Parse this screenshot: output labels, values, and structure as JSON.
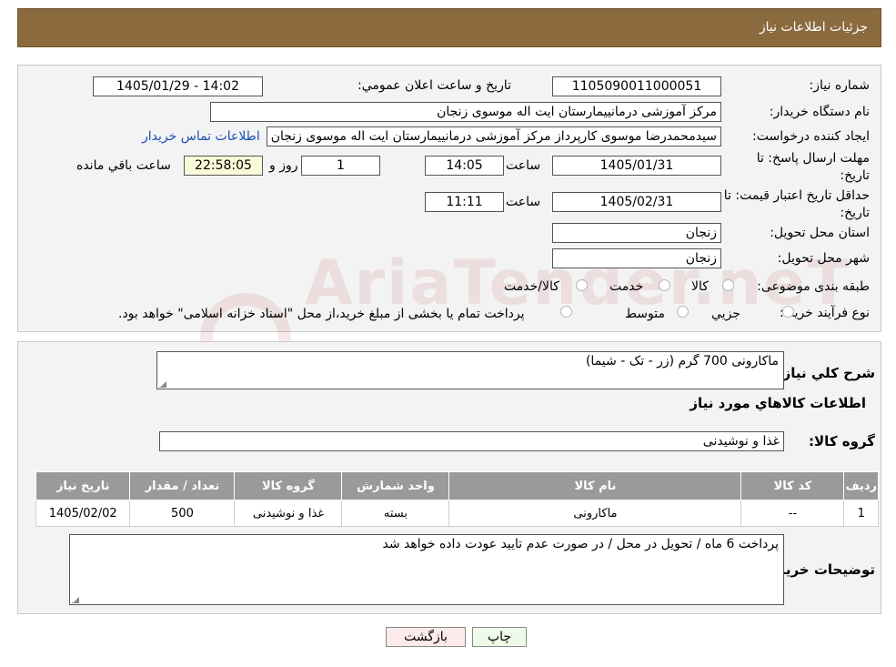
{
  "header": {
    "title": "جزئیات اطلاعات نیاز"
  },
  "form": {
    "need_number_label": "شماره نیاز:",
    "need_number": "1105090011000051",
    "announce_label": "تاریخ و ساعت اعلان عمومي:",
    "announce_value": "1405/01/29 - 14:02",
    "buyer_org_label": "نام دستگاه خريدار:",
    "buyer_org": "مرکز آموزشی درمانییمارستان ایت اله موسوی زنجان",
    "creator_label": "ايجاد کننده درخواست:",
    "creator": "سیدمحمدرضا موسوی کارپرداز مرکز آموزشی درمانییمارستان ایت اله موسوی زنجان",
    "contact_link": "اطلاعات تماس خريدار",
    "deadline_label_1": "مهلت ارسال پاسخ: تا",
    "deadline_label_2": "تاريخ:",
    "deadline_date": "1405/01/31",
    "time_label": "ساعت",
    "deadline_time": "14:05",
    "days_value": "1",
    "days_label": "روز و",
    "remaining_time": "22:58:05",
    "remaining_label": "ساعت باقي مانده",
    "validity_label_1": "حداقل تاريخ اعتبار قيمت: تا",
    "validity_label_2": "تاريخ:",
    "validity_date": "1405/02/31",
    "validity_time": "11:11",
    "province_label": "استان محل تحويل:",
    "province": "زنجان",
    "city_label": "شهر محل تحويل:",
    "city": "زنجان",
    "category_label": "طبقه بندی موضوعی:",
    "category_options": [
      "کالا",
      "خدمت",
      "کالا/خدمت"
    ],
    "process_label": "نوع فرآیند خرید :",
    "process_options": [
      "جزيي",
      "متوسط"
    ],
    "process_note": "پرداخت تمام يا بخشی از مبلغ خريد،از محل \"اسناد خزانه اسلامی\" خواهد بود."
  },
  "watermark": "AriaTender.neT",
  "details": {
    "summary_label": "شرح کلي نياز:",
    "summary": "ماکارونی 700 گرم (زر - تک - شیما)",
    "goods_info_title": "اطلاعات کالاهاي مورد نياز",
    "goods_group_label": "گروه کالا:",
    "goods_group": "غذا و نوشیدنی",
    "table": {
      "headers": [
        "رديف",
        "کد کالا",
        "نام کالا",
        "واحد شمارش",
        "گروه کالا",
        "تعداد / مقدار",
        "تاريخ نياز"
      ],
      "rows": [
        [
          "1",
          "--",
          "ماکارونی",
          "بسته",
          "غذا و نوشیدنی",
          "500",
          "1405/02/02"
        ]
      ]
    },
    "buyer_notes_label": "توضيحات خريدار:",
    "buyer_notes": "پرداخت 6 ماه / تحویل در محل / در صورت عدم تایید عودت داده خواهد شد"
  },
  "buttons": {
    "print": "چاپ",
    "back": "بازگشت"
  },
  "colors": {
    "header_bg": "#8b6a3e",
    "table_header_bg": "#9a9a9a",
    "print_bg": "#eefbe9",
    "back_bg": "#fdeaea"
  }
}
